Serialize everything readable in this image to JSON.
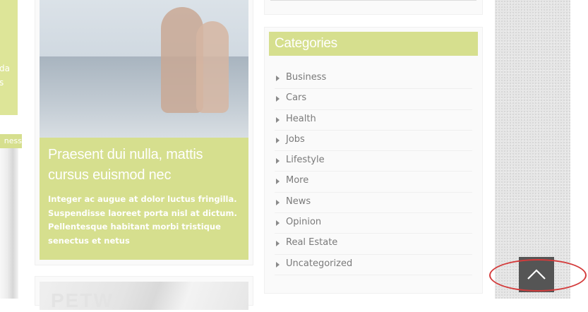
{
  "left_column": {
    "top_fragments": [
      "da",
      "s"
    ],
    "tag_fragment": "ness"
  },
  "post": {
    "title": "Praesent dui nulla, mattis cursus euismod nec",
    "excerpt": "Integer ac augue at dolor luctus fringilla. Suspendisse laoreet porta nisl at dictum. Pellentesque habitant morbi tristique senectus et netus",
    "next_fragment": "PETW"
  },
  "categories": {
    "title": "Categories",
    "items": [
      "Business",
      "Cars",
      "Health",
      "Jobs",
      "Lifestyle",
      "More",
      "News",
      "Opinion",
      "Real Estate",
      "Uncategorized"
    ]
  },
  "colors": {
    "accent": "#d6df8e",
    "scroll_button": "#555555",
    "highlight": "#d43b3b"
  },
  "icons": {
    "scroll_top": "chevron-up-icon",
    "category_bullet": "caret-right-icon"
  }
}
